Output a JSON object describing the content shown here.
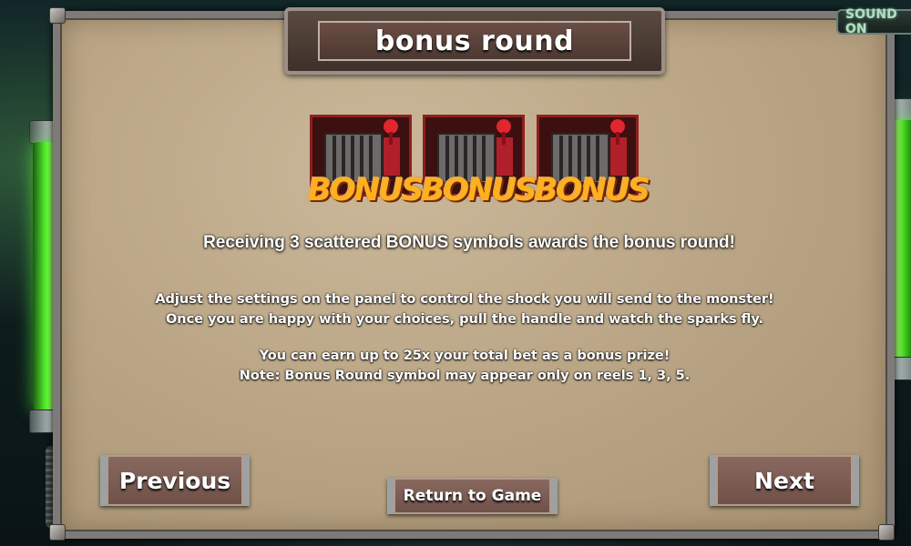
{
  "title": "bonus round",
  "sound_toggle": "SOUND ON",
  "symbols": [
    "BONUS",
    "BONUS",
    "BONUS"
  ],
  "headline": "Receiving 3 scattered BONUS symbols awards the bonus round!",
  "paragraph1": {
    "line1": "Adjust the settings on the panel to control the shock you will send to the monster!",
    "line2": "Once you are happy with your choices, pull the handle and watch the sparks fly."
  },
  "paragraph2": {
    "line1": "You can earn up to 25x your total bet as a bonus prize!",
    "line2": "Note: Bonus Round symbol may appear only on reels 1, 3, 5."
  },
  "buttons": {
    "previous": "Previous",
    "next": "Next",
    "return": "Return to Game"
  },
  "colors": {
    "panel": "#b9a585",
    "tube_glow": "#5dff33",
    "button": "#7a5c52",
    "symbol_text": "#ffb020",
    "symbol_frame": "#8e1f1f"
  },
  "icons": [
    "bonus-cage-icon",
    "electric-tube-icon"
  ]
}
